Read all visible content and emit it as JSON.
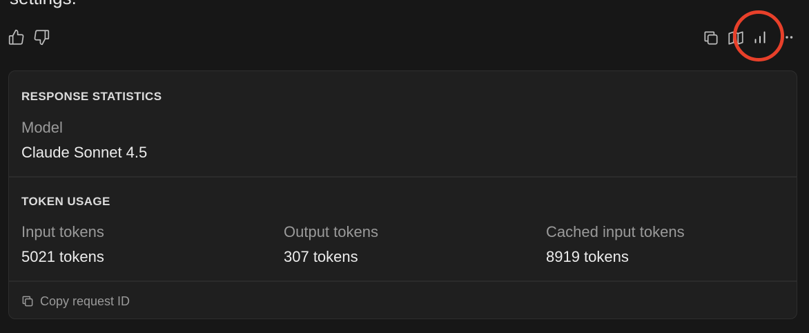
{
  "previous_message": {
    "trailing_text": "settings."
  },
  "action_bar": {
    "left_icons": [
      "thumbs-up-icon",
      "thumbs-down-icon"
    ],
    "right_icons": [
      "copy-icon",
      "map-icon",
      "bar-chart-icon",
      "more-icon"
    ],
    "highlight_color": "#e8402a"
  },
  "response_statistics": {
    "title": "RESPONSE STATISTICS",
    "model_label": "Model",
    "model_value": "Claude Sonnet 4.5"
  },
  "token_usage": {
    "title": "TOKEN USAGE",
    "input_label": "Input tokens",
    "input_value": "5021 tokens",
    "output_label": "Output tokens",
    "output_value": "307 tokens",
    "cached_label": "Cached input tokens",
    "cached_value": "8919 tokens"
  },
  "footer": {
    "copy_request_label": "Copy request ID"
  }
}
